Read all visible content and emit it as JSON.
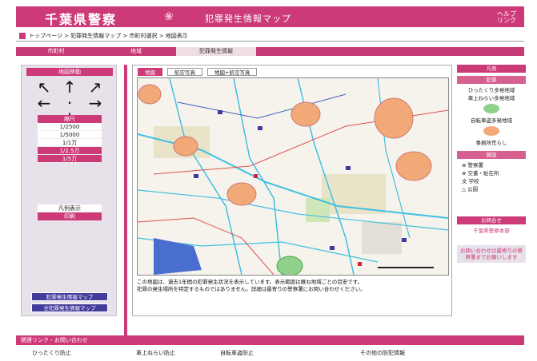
{
  "header": {
    "logo": "千葉県警察",
    "app_title": "犯罪発生情報マップ",
    "help_line1": "ヘルプ",
    "help_line2": "リンク"
  },
  "breadcrumb": "トップページ > 犯罪発生情報マップ > 市町村選択 > 地図表示",
  "tabs": [
    "市町村",
    "地域",
    "犯罪発生情報"
  ],
  "side": {
    "move_title": "地図移動",
    "zoom_title": "縮尺",
    "zoom_items": [
      "1/2500",
      "1/5000",
      "1/1万",
      "1/2.5万",
      "1/5万"
    ],
    "zoom_selected": 3,
    "extra_title": "凡例表示",
    "extra_item": "印刷",
    "bottom_btn1": "犯罪発生情報マップ",
    "bottom_btn2": "全犯罪発生情報マップ"
  },
  "map": {
    "tabs": [
      "地図",
      "航空写真",
      "地図+航空写真"
    ],
    "notes": [
      "この地図は、過去1年間の犯罪発生状況を表示しています。表示範囲は概ね地域ごとの目安です。",
      "犯罪の発生場所を特定するものではありません。詳細は最寄りの警察署にお問い合わせください。"
    ]
  },
  "legend": {
    "title": "凡例",
    "sub1": "犯罪",
    "items": [
      "ひったくり多発地域",
      "車上ねらい多発地域",
      "自転車盗多発地域",
      "事務所荒らし"
    ],
    "sub2": "施設",
    "facilities": [
      "警察署",
      "交番・駐在所",
      "学校",
      "公園"
    ],
    "sub3": "お問合せ",
    "contact": "千葉県警察本部",
    "contact_note": "お問い合わせは最寄りの警察署までお願いします"
  },
  "footer": {
    "title": "関連リンク・お問い合わせ",
    "links": [
      "ひったくり防止",
      "車上ねらい防止",
      "自転車盗防止",
      "その他の防犯情報"
    ]
  },
  "colors": {
    "accent": "#cc3a78",
    "button": "#443c9c"
  }
}
